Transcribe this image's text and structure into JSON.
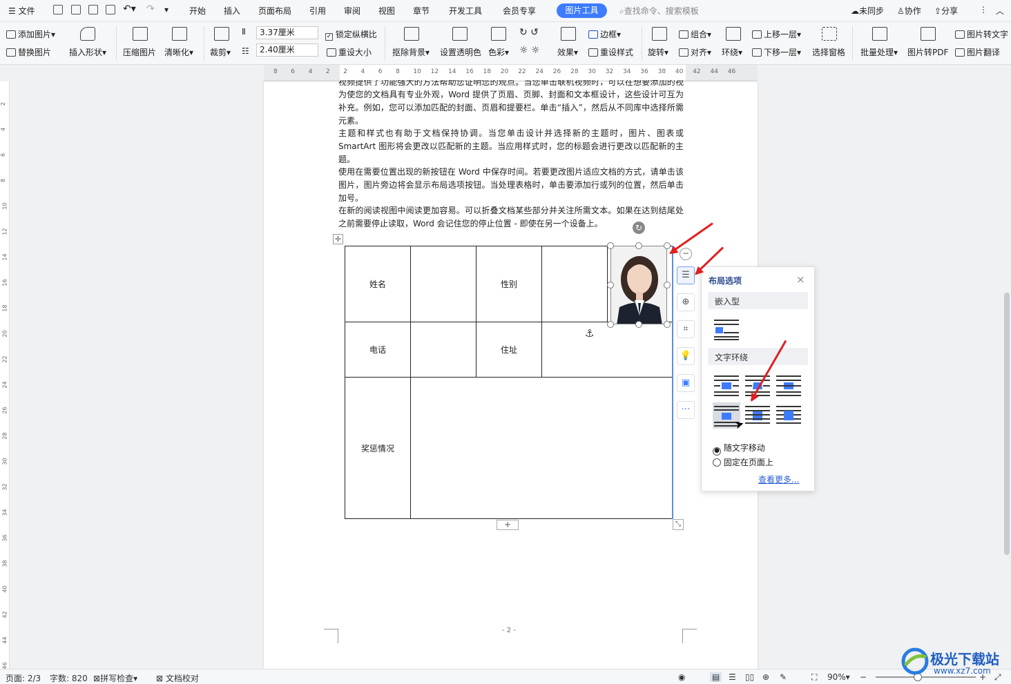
{
  "menu": {
    "file": "文件",
    "tabs": [
      "开始",
      "插入",
      "页面布局",
      "引用",
      "审阅",
      "视图",
      "章节",
      "开发工具",
      "会员专享"
    ],
    "active_tab": "图片工具",
    "search_placeholder": "查找命令、搜索模板",
    "sync": "未同步",
    "collab": "协作",
    "share": "分享"
  },
  "ribbon": {
    "add_picture": "添加图片",
    "replace_picture": "替换图片",
    "insert_shape": "插入形状",
    "compress": "压缩图片",
    "clarify": "清晰化",
    "crop": "裁剪",
    "height_value": "3.37厘米",
    "width_value": "2.40厘米",
    "lock_ratio": "锁定纵横比",
    "reset_size": "重设大小",
    "remove_bg": "抠除背景",
    "set_transparent": "设置透明色",
    "color": "色彩",
    "effects": "效果",
    "border": "边框",
    "reset_style": "重设样式",
    "rotate": "旋转",
    "group": "组合",
    "align": "对齐",
    "wrap": "环绕",
    "bring_forward": "上移一层",
    "send_backward": "下移一层",
    "selection_pane": "选择窗格",
    "batch": "批量处理",
    "to_pdf": "图片转PDF",
    "to_text": "图片转文字",
    "translate": "图片翻译"
  },
  "ruler": [
    "8",
    "6",
    "4",
    "2",
    "2",
    "4",
    "6",
    "8",
    "10",
    "12",
    "14",
    "16",
    "18",
    "20",
    "22",
    "24",
    "26",
    "28",
    "30",
    "32",
    "34",
    "36",
    "38",
    "40",
    "42",
    "44",
    "46"
  ],
  "vruler": [
    "2",
    "4",
    "6",
    "8",
    "10",
    "12",
    "14",
    "16",
    "18",
    "20",
    "22",
    "24",
    "26",
    "28",
    "30",
    "32",
    "34",
    "36",
    "38",
    "40",
    "42",
    "44",
    "46"
  ],
  "document": {
    "paragraphs": [
      "视频提供了功能强大的方法帮助您证明您的观点。当您单击联机视频时，可以在想要添加的视频的嵌入代码中进行粘贴。您也可以键入一个关键字以联机搜索最适合您的文档的视频。",
      "为使您的文档具有专业外观，Word 提供了页眉、页脚、封面和文本框设计，这些设计可互为补充。例如，您可以添加匹配的封面、页眉和提要栏。单击“插入”，然后从不同库中选择所需元素。",
      "主题和样式也有助于文档保持协调。当您单击设计并选择新的主题时，图片、图表或 SmartArt 图形将会更改以匹配新的主题。当应用样式时，您的标题会进行更改以匹配新的主题。",
      "使用在需要位置出现的新按钮在 Word 中保存时间。若要更改图片适应文档的方式，请单击该图片，图片旁边将会显示布局选项按钮。当处理表格时，单击要添加行或列的位置，然后单击加号。",
      "在新的阅读视图中阅读更加容易。可以折叠文档某些部分并关注所需文本。如果在达到结尾处之前需要停止读取，Word 会记住您的停止位置 - 即使在另一个设备上。"
    ],
    "table": {
      "name_label": "姓名",
      "gender_label": "性别",
      "phone_label": "电话",
      "address_label": "住址",
      "awards_label": "奖惩情况"
    },
    "page_number": "- 2 -"
  },
  "layout_panel": {
    "title": "布局选项",
    "inline_section": "嵌入型",
    "wrap_section": "文字环绕",
    "move_with_text": "随文字移动",
    "fix_on_page": "固定在页面上",
    "see_more": "查看更多..."
  },
  "status": {
    "page": "页面: 2/3",
    "words": "字数: 820",
    "spell": "拼写检查",
    "proof": "文档校对",
    "zoom": "90%"
  },
  "watermark": {
    "brand": "极光下载站",
    "url": "www.xz7.com"
  },
  "colors": {
    "accent": "#3d7bff",
    "arrow": "#e02020",
    "link": "#2a5fd1"
  }
}
